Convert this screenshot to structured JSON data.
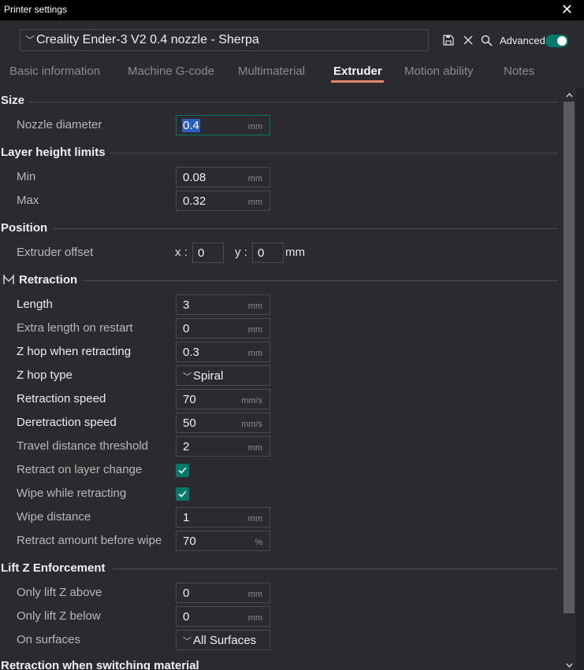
{
  "window": {
    "title": "Printer settings"
  },
  "toolbar": {
    "preset": "Creality Ender-3 V2 0.4 nozzle - Sherpa",
    "advanced_label": "Advanced",
    "advanced_on": true
  },
  "tabs": [
    "Basic information",
    "Machine G-code",
    "Multimaterial",
    "Extruder",
    "Motion ability",
    "Notes"
  ],
  "active_tab": "Extruder",
  "colors": {
    "accent": "#00796b",
    "tab_underline": "#e0876a",
    "selection": "#2a5fbf"
  },
  "sections": {
    "size": {
      "title": "Size",
      "nozzle_diameter": {
        "label": "Nozzle diameter",
        "value": "0.4",
        "unit": "mm"
      }
    },
    "layer_height_limits": {
      "title": "Layer height limits",
      "min": {
        "label": "Min",
        "value": "0.08",
        "unit": "mm"
      },
      "max": {
        "label": "Max",
        "value": "0.32",
        "unit": "mm"
      }
    },
    "position": {
      "title": "Position",
      "extruder_offset": {
        "label": "Extruder offset",
        "x_label": "x :",
        "x": "0",
        "y_label": "y :",
        "y": "0",
        "unit": "mm"
      }
    },
    "retraction": {
      "title": "Retraction",
      "length": {
        "label": "Length",
        "value": "3",
        "unit": "mm"
      },
      "extra_length": {
        "label": "Extra length on restart",
        "value": "0",
        "unit": "mm"
      },
      "z_hop": {
        "label": "Z hop when retracting",
        "value": "0.3",
        "unit": "mm"
      },
      "z_hop_type": {
        "label": "Z hop type",
        "value": "Spiral"
      },
      "retraction_speed": {
        "label": "Retraction speed",
        "value": "70",
        "unit": "mm/s"
      },
      "deretraction_speed": {
        "label": "Deretraction speed",
        "value": "50",
        "unit": "mm/s"
      },
      "travel_threshold": {
        "label": "Travel distance threshold",
        "value": "2",
        "unit": "mm"
      },
      "retract_layer_change": {
        "label": "Retract on layer change",
        "checked": true
      },
      "wipe_retracting": {
        "label": "Wipe while retracting",
        "checked": true
      },
      "wipe_distance": {
        "label": "Wipe distance",
        "value": "1",
        "unit": "mm"
      },
      "retract_before_wipe": {
        "label": "Retract amount before wipe",
        "value": "70",
        "unit": "%"
      }
    },
    "lift_z": {
      "title": "Lift Z Enforcement",
      "above": {
        "label": "Only lift Z above",
        "value": "0",
        "unit": "mm"
      },
      "below": {
        "label": "Only lift Z below",
        "value": "0",
        "unit": "mm"
      },
      "surfaces": {
        "label": "On surfaces",
        "value": "All Surfaces"
      }
    },
    "switching": {
      "title": "Retraction when switching material"
    }
  }
}
